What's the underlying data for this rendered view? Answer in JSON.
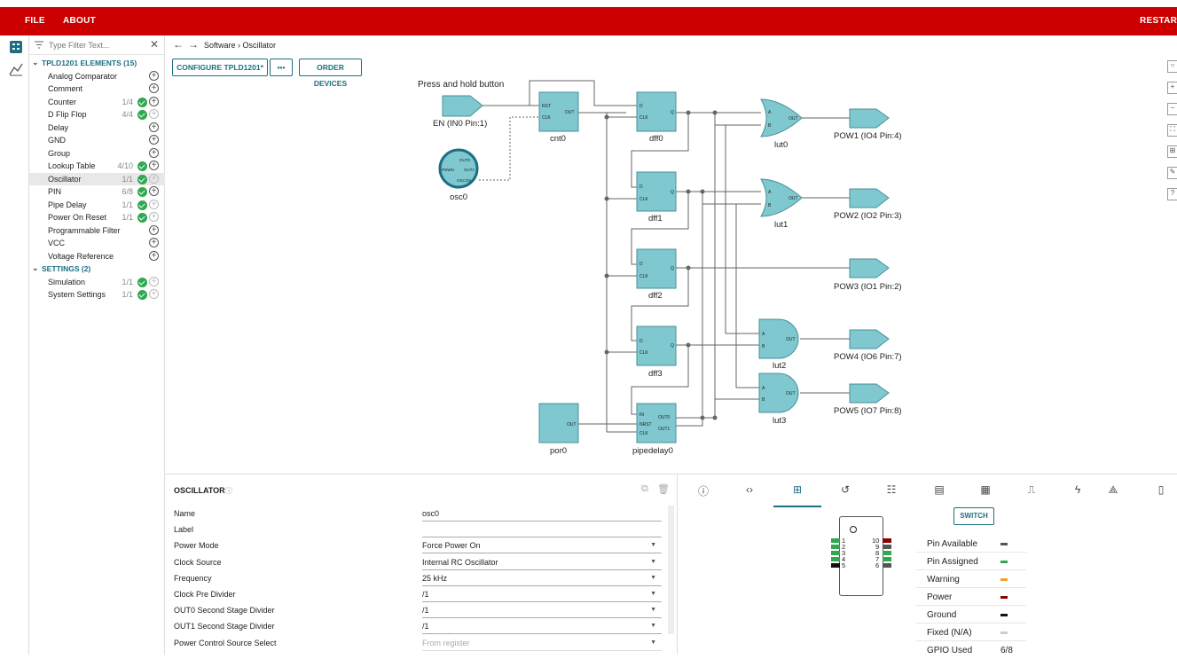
{
  "menu": {
    "file": "FILE",
    "about": "ABOUT",
    "restart": "RESTART"
  },
  "sidebar": {
    "filter_placeholder": "Type Filter Text...",
    "elements_header": "TPLD1201 ELEMENTS (15)",
    "items": [
      {
        "label": "Analog Comparator",
        "count": "",
        "status": "none"
      },
      {
        "label": "Comment",
        "count": "",
        "status": "none"
      },
      {
        "label": "Counter",
        "count": "1/4",
        "status": "ok"
      },
      {
        "label": "D Flip Flop",
        "count": "4/4",
        "status": "ok-full"
      },
      {
        "label": "Delay",
        "count": "",
        "status": "none"
      },
      {
        "label": "GND",
        "count": "",
        "status": "none"
      },
      {
        "label": "Group",
        "count": "",
        "status": "none"
      },
      {
        "label": "Lookup Table",
        "count": "4/10",
        "status": "ok"
      },
      {
        "label": "Oscillator",
        "count": "1/1",
        "status": "ok-full"
      },
      {
        "label": "PIN",
        "count": "6/8",
        "status": "ok"
      },
      {
        "label": "Pipe Delay",
        "count": "1/1",
        "status": "ok-full"
      },
      {
        "label": "Power On Reset",
        "count": "1/1",
        "status": "ok-full"
      },
      {
        "label": "Programmable Filter",
        "count": "",
        "status": "none"
      },
      {
        "label": "VCC",
        "count": "",
        "status": "none"
      },
      {
        "label": "Voltage Reference",
        "count": "",
        "status": "none"
      }
    ],
    "settings_header": "SETTINGS (2)",
    "settings": [
      {
        "label": "Simulation",
        "count": "1/1",
        "status": "ok-full"
      },
      {
        "label": "System Settings",
        "count": "1/1",
        "status": "ok-full"
      }
    ],
    "selected": "Oscillator"
  },
  "breadcrumb": {
    "path": "Software › Oscillator"
  },
  "toolbar": {
    "configure": "CONFIGURE TPLD1201*",
    "more": "•••",
    "order": "ORDER DEVICES"
  },
  "schematic": {
    "note": "Press and hold button",
    "input_label": "EN (IN0 Pin:1)",
    "blocks": {
      "cnt0": {
        "name": "cnt0",
        "pins": [
          "RST",
          "CLK",
          "OUT"
        ]
      },
      "osc0": {
        "name": "osc0",
        "pins": [
          "PDWN",
          "OUT0",
          "OUT1",
          "OSC/25"
        ]
      },
      "dff0": {
        "name": "dff0"
      },
      "dff1": {
        "name": "dff1"
      },
      "dff2": {
        "name": "dff2"
      },
      "dff3": {
        "name": "dff3"
      },
      "lut0": {
        "name": "lut0"
      },
      "lut1": {
        "name": "lut1"
      },
      "lut2": {
        "name": "lut2"
      },
      "lut3": {
        "name": "lut3"
      },
      "por0": {
        "name": "por0"
      },
      "pipedelay0": {
        "name": "pipedelay0",
        "pins": [
          "IN",
          "NRST",
          "CLK",
          "OUT0",
          "OUT1"
        ]
      }
    },
    "dff_pins": [
      "D",
      "CLK",
      "Q"
    ],
    "lut_pins": [
      "A",
      "B",
      "OUT"
    ],
    "por_pin": "OUT",
    "outputs": [
      "POW1 (IO4 Pin:4)",
      "POW2 (IO2 Pin:3)",
      "POW3 (IO1 Pin:2)",
      "POW4 (IO6 Pin:7)",
      "POW5 (IO7 Pin:8)"
    ]
  },
  "properties": {
    "title": "OSCILLATOR",
    "rows": [
      {
        "key": "Name",
        "value": "osc0",
        "dropdown": false,
        "dim": false
      },
      {
        "key": "Label",
        "value": "",
        "dropdown": false,
        "dim": false
      },
      {
        "key": "Power Mode",
        "value": "Force Power On",
        "dropdown": true,
        "dim": false
      },
      {
        "key": "Clock Source",
        "value": "Internal RC Oscillator",
        "dropdown": true,
        "dim": false
      },
      {
        "key": "Frequency",
        "value": "25 kHz",
        "dropdown": true,
        "dim": false
      },
      {
        "key": "Clock Pre Divider",
        "value": "/1",
        "dropdown": true,
        "dim": false
      },
      {
        "key": "OUT0 Second Stage Divider",
        "value": "/1",
        "dropdown": true,
        "dim": false
      },
      {
        "key": "OUT1 Second Stage Divider",
        "value": "/1",
        "dropdown": true,
        "dim": false
      },
      {
        "key": "Power Control Source Select",
        "value": "From register",
        "dropdown": true,
        "dim": true
      }
    ]
  },
  "pinout": {
    "switch": "SWITCH",
    "left_pins": [
      "1",
      "2",
      "3",
      "4",
      "5"
    ],
    "right_pins": [
      "10",
      "9",
      "8",
      "7",
      "6"
    ],
    "legend": [
      {
        "label": "Pin Available",
        "color": "#555555"
      },
      {
        "label": "Pin Assigned",
        "color": "#2fa84f"
      },
      {
        "label": "Warning",
        "color": "#f0a030"
      },
      {
        "label": "Power",
        "color": "#8b0000"
      },
      {
        "label": "Ground",
        "color": "#111111"
      },
      {
        "label": "Fixed (N/A)",
        "color": "#cccccc"
      }
    ],
    "gpio_label": "GPIO Used",
    "gpio_value": "6/8"
  },
  "colors": {
    "accent": "#cc0000",
    "teal": "#1c6f82",
    "block": "#7fc8cf"
  }
}
